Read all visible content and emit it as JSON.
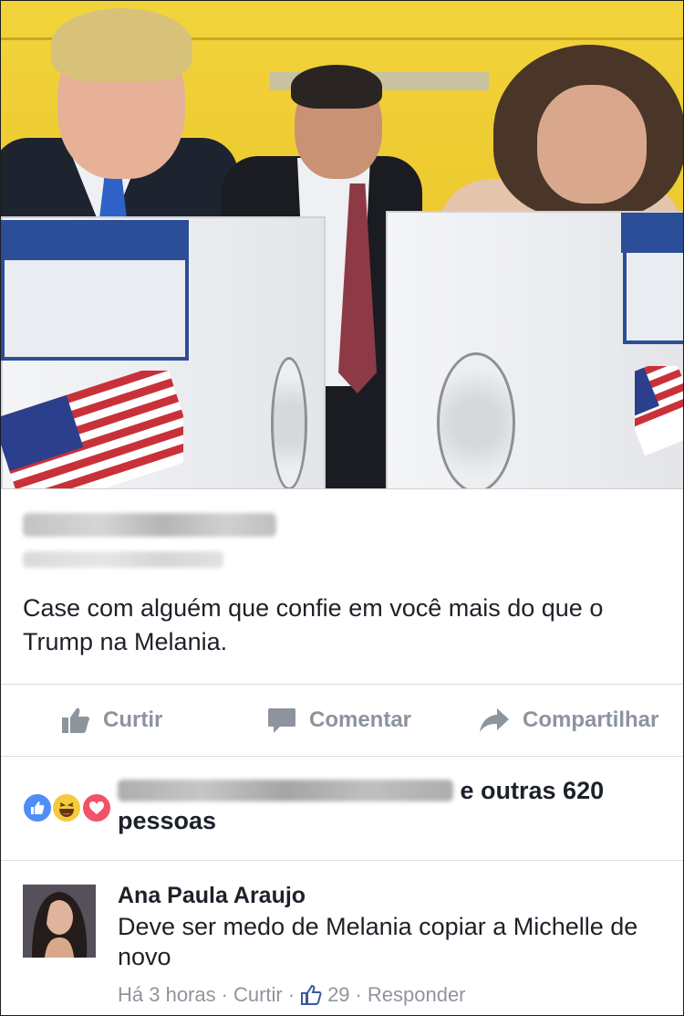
{
  "photo": {
    "description_icon": "voting-booth-photo"
  },
  "post": {
    "text": "Case com alguém que confie em você mais do que o Trump na Melania."
  },
  "actions": {
    "like_label": "Curtir",
    "comment_label": "Comentar",
    "share_label": "Compartilhar",
    "icon_color": "#8d949e"
  },
  "reactions": {
    "suffix": "e outras 620 pessoas",
    "icons": [
      "like-reaction-icon",
      "haha-reaction-icon",
      "love-reaction-icon"
    ]
  },
  "comment": {
    "author": "Ana Paula Araujo",
    "text": "Deve ser medo de Melania copiar a Michelle de novo",
    "time": "Há 3 horas",
    "like_label": "Curtir",
    "like_count": "29",
    "reply_label": "Responder"
  },
  "colors": {
    "text": "#1d2129",
    "muted": "#90949c",
    "like_blue": "#3b5998"
  }
}
